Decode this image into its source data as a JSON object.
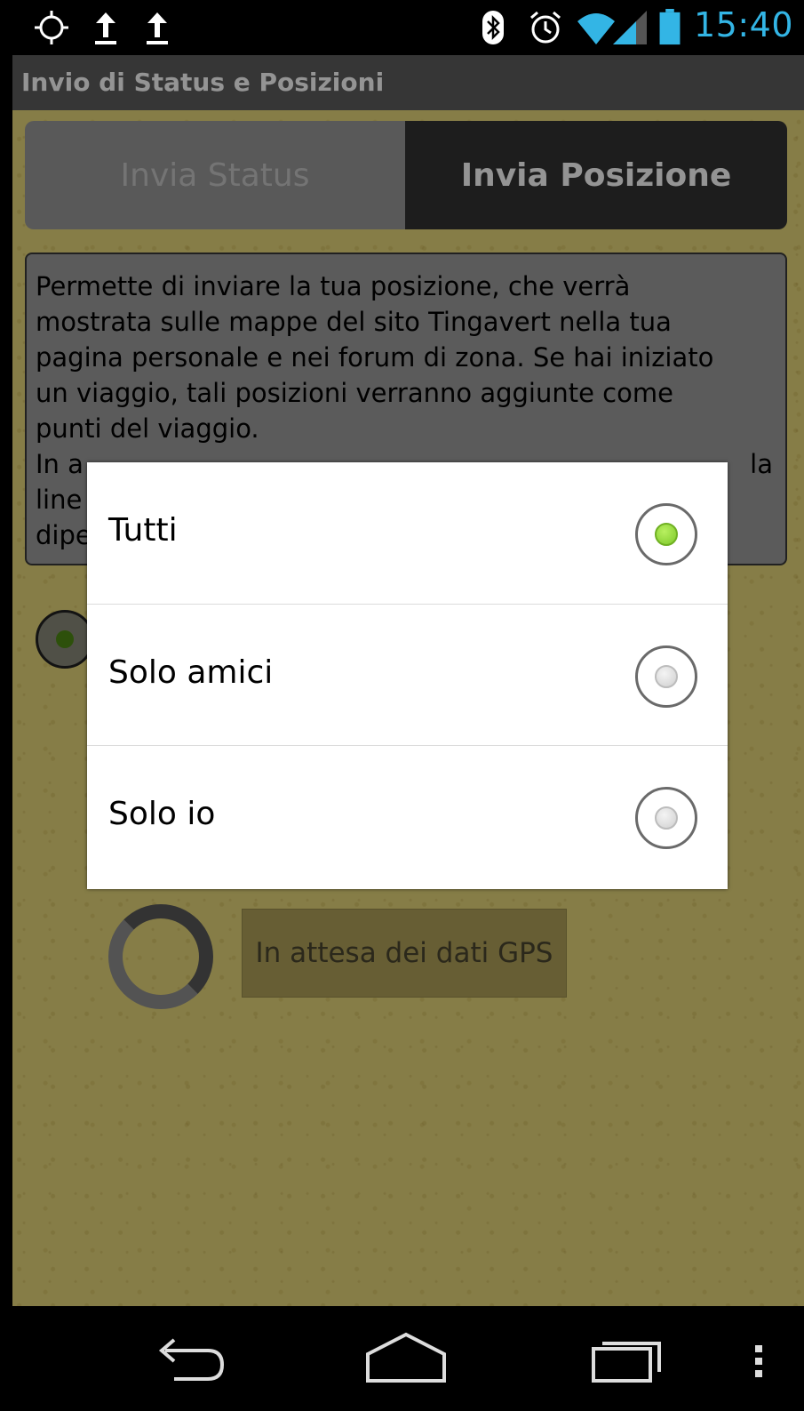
{
  "status_bar": {
    "time": "15:40",
    "icons": [
      "gps-icon",
      "upload-icon",
      "upload-icon",
      "bluetooth-icon",
      "alarm-icon",
      "wifi-icon",
      "signal-icon",
      "battery-icon"
    ]
  },
  "action_bar": {
    "title": "Invio di Status e Posizioni"
  },
  "tabs": [
    {
      "label": "Invia Status",
      "selected": false
    },
    {
      "label": "Invia Posizione",
      "selected": true
    }
  ],
  "info_text": {
    "visible_lines": [
      "Permette di inviare la tua posizione, che verrà",
      "mostrata sulle mappe del sito Tingavert nella tua",
      "pagina personale e nei forum di zona. Se hai iniziato",
      "un viaggio, tali posizioni verranno aggiunte come",
      "punti del viaggio.",
      "In a",
      "line",
      "dipe"
    ],
    "line6_right": "la"
  },
  "gps_button": {
    "label": "In attesa dei dati GPS"
  },
  "dialog": {
    "options": [
      {
        "label": "Tutti",
        "checked": true
      },
      {
        "label": "Solo amici",
        "checked": false
      },
      {
        "label": "Solo io",
        "checked": false
      }
    ]
  },
  "nav_bar": {
    "icons": [
      "back-icon",
      "home-icon",
      "recent-apps-icon",
      "menu-icon"
    ]
  },
  "colors": {
    "accent": "#33b5e5",
    "radio_checked": "#7ec92a",
    "background": "#e7d87a"
  }
}
